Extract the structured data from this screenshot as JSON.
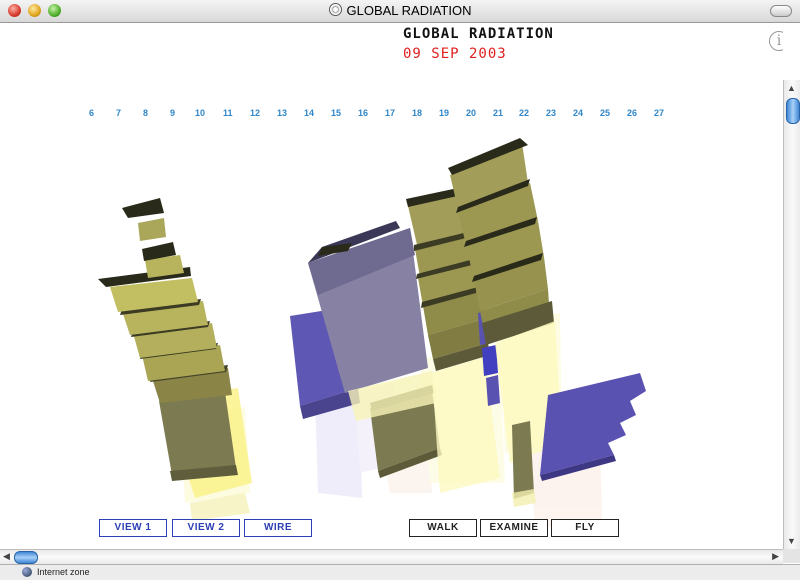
{
  "window": {
    "title": "GLOBAL RADIATION"
  },
  "header": {
    "title": "GLOBAL RADIATION",
    "date": "09 SEP 2003"
  },
  "hours": [
    "6",
    "7",
    "8",
    "9",
    "10",
    "11",
    "12",
    "13",
    "14",
    "15",
    "16",
    "17",
    "18",
    "19",
    "20",
    "21",
    "22",
    "23",
    "24",
    "25",
    "26",
    "27"
  ],
  "nav_buttons": {
    "view1": "VIEW 1",
    "view2": "VIEW 2",
    "wire": "WIRE",
    "walk": "WALK",
    "examine": "EXAMINE",
    "fly": "FLY"
  },
  "status": {
    "zone": "Internet zone"
  },
  "colors": {
    "olive": "#9c9a64",
    "yellow": "#e8e070",
    "violet": "#5a52b0",
    "hour_label": "#2f86c9",
    "date": "#e02020"
  }
}
